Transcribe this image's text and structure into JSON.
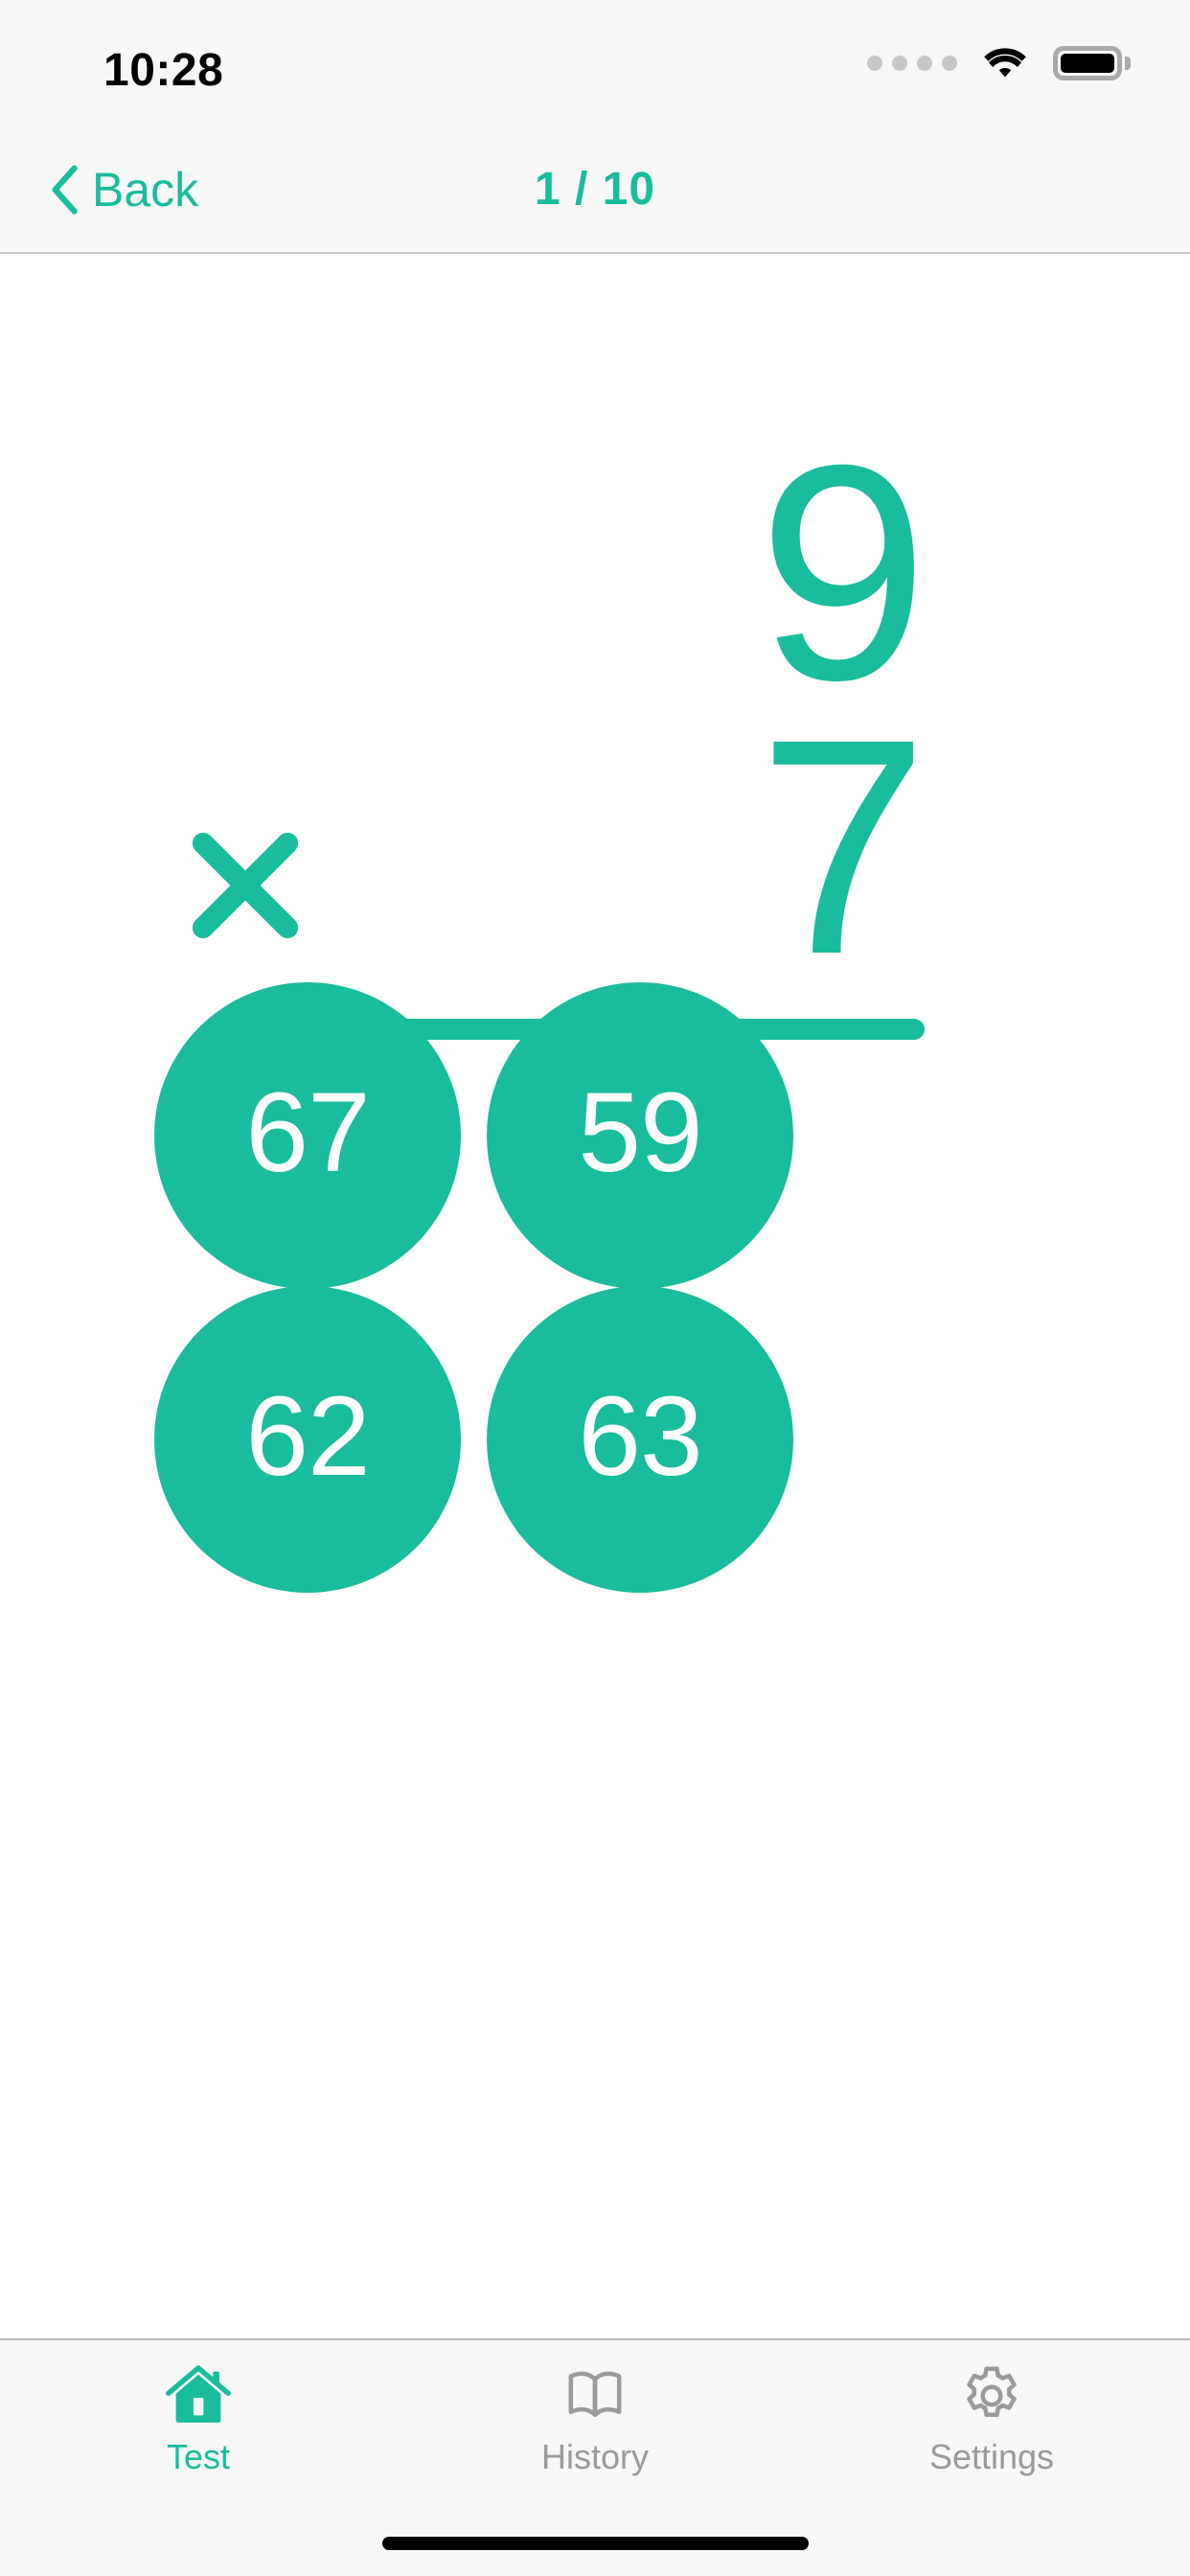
{
  "status_bar": {
    "time": "10:28",
    "signal_icon": "signal-dots-icon",
    "wifi_icon": "wifi-icon",
    "battery_icon": "battery-full-icon"
  },
  "nav_bar": {
    "back_icon": "chevron-left-icon",
    "back_label": "Back",
    "progress": "1 / 10",
    "current_question": 1,
    "total_questions": 10
  },
  "problem": {
    "operand_top": "9",
    "operator": "×",
    "operator_icon": "multiply-icon",
    "operand_bottom": "7",
    "answer": 63
  },
  "answers": [
    {
      "label": "67"
    },
    {
      "label": "59"
    },
    {
      "label": "62"
    },
    {
      "label": "63"
    }
  ],
  "tab_bar": {
    "items": [
      {
        "label": "Test",
        "icon": "home-icon",
        "active": true
      },
      {
        "label": "History",
        "icon": "book-icon",
        "active": false
      },
      {
        "label": "Settings",
        "icon": "gear-icon",
        "active": false
      }
    ]
  },
  "colors": {
    "accent": "#19bc9c",
    "chrome_background": "#f7f7f7",
    "content_background": "#ffffff",
    "inactive_tab": "#9a9a9a",
    "separator": "#c8c8c8"
  }
}
